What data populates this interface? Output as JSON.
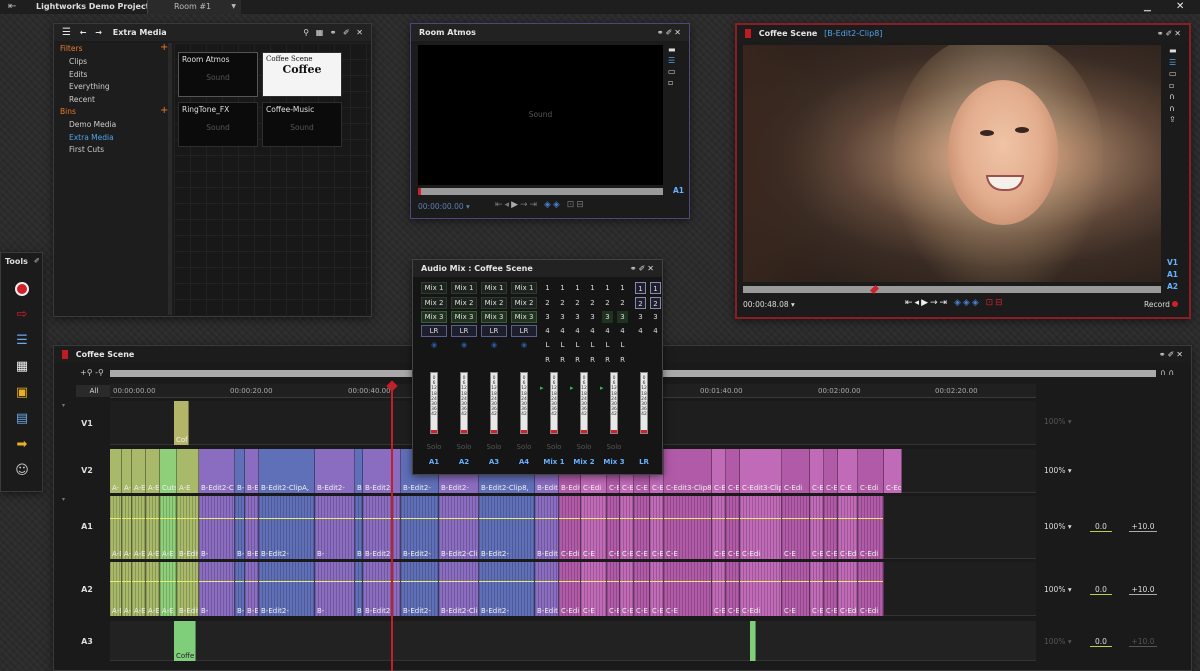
{
  "app": {
    "project_title": "Lightworks Demo Project",
    "room": "Room #1"
  },
  "extra_media": {
    "title": "Extra Media",
    "filters_label": "Filters",
    "filters": [
      "Clips",
      "Edits",
      "Everything",
      "Recent"
    ],
    "bins_label": "Bins",
    "bins": [
      "Demo Media",
      "Extra Media",
      "First Cuts"
    ],
    "selected_bin": "Extra Media",
    "tiles": [
      {
        "name": "Room Atmos",
        "sub": "Sound"
      },
      {
        "name": "Coffee Scene",
        "sub": "Coffee"
      },
      {
        "name": "RingTone_FX",
        "sub": "Sound"
      },
      {
        "name": "Coffee-Music",
        "sub": "Sound"
      }
    ]
  },
  "room_atmos": {
    "title": "Room Atmos",
    "sound": "Sound",
    "timecode": "00:00:00.00",
    "track": "A1"
  },
  "coffee_viewer": {
    "title": "Coffee Scene",
    "subtitle": "[B-Edit2-Clip8]",
    "timecode": "00:00:48.08",
    "record": "Record",
    "tracks": [
      "V1",
      "A1",
      "A2"
    ]
  },
  "audio_mix": {
    "title": "Audio Mix : Coffee Scene",
    "mix_rows": [
      "Mix 1",
      "Mix 2",
      "Mix 3"
    ],
    "lr": "LR",
    "channels": [
      "A1",
      "A2",
      "A3",
      "A4",
      "Mix 1",
      "Mix 2",
      "Mix 3",
      "LR"
    ],
    "solo": "Solo",
    "fader_scale": [
      "0",
      "6",
      "12",
      "18",
      "24",
      "30",
      "36",
      "42"
    ],
    "lr_letters": [
      "L",
      "R"
    ]
  },
  "tools": {
    "title": "Tools",
    "items": [
      "record-icon",
      "import-icon",
      "timeline-icon",
      "grid-icon",
      "folder-icon",
      "export-icon",
      "arrow-icon",
      "users-icon"
    ]
  },
  "timeline": {
    "title": "Coffee Scene",
    "all": "All",
    "ruler": [
      "00:00:00.00",
      "00:00:20.00",
      "00:00:40.00",
      "00:01:40.00",
      "00:02:00.00",
      "00:02:20.00"
    ],
    "tracks": [
      "V1",
      "V2",
      "A1",
      "A2",
      "A3"
    ],
    "v1_clip": "Cof",
    "a3_clip": "Coffe",
    "v2_clips": [
      "A-",
      "A-E",
      "A-E",
      "A-E",
      "Cuts",
      "A-E",
      "B-Edit2-C",
      "B-",
      "B-E",
      "B-Edit2-ClipA,",
      "B-Edit2-",
      "B-",
      "B-Edit2-",
      "B-Edit2-",
      "B-Edit2-",
      "B-Edit2-Clip8,",
      "B-Edit2-",
      "B-Edit2-Cli",
      "C-Edi",
      "C-E",
      "C-E",
      "C-E",
      "C-E",
      "C-Edit3-Clip8,",
      "C-E",
      "C-E",
      "C-Edit3-ClipA,",
      "C-Edi",
      "C-E",
      "C-E",
      "C-E",
      "C-Edi",
      "C-Edi"
    ],
    "a_clips": [
      "A-Ed",
      "A-E",
      "A-E",
      "A-Ed",
      "A-E",
      "B-Edit2-C",
      "B-",
      "B-E",
      "B-Edit2-ClipA,",
      "B-Edit2-",
      "B-",
      "B-Edit2-",
      "B-Edit2-",
      "B-Edit2-",
      "B-Edit2-Clip8, E",
      "B-Edit2-",
      "B-Edit2-Cli",
      "C-Edi",
      "C-E",
      "C-E",
      "C-E",
      "C-E",
      "C-Edit3-Clip8, E",
      "C-E",
      "C-E",
      "C-Edit3-ClipA, E",
      "C-Edi",
      "C-E",
      "C-E",
      "C-E",
      "C-Edi",
      "C-Edi"
    ],
    "levels": {
      "v2": "100%",
      "a1": "100%",
      "a2": "100%",
      "v1": "100%",
      "a3": "100%"
    },
    "gain": {
      "a1_left": "0.0",
      "a1_right": "+10.0",
      "a2_left": "0.0",
      "a2_right": "+10.0",
      "a3_left": "0.0",
      "a3_right": "+10.0"
    }
  },
  "colors": {
    "accent": "#e87a2a",
    "record_red": "#d0202a",
    "link_blue": "#4fa3e8",
    "panel_border_red": "#8b1e25"
  }
}
